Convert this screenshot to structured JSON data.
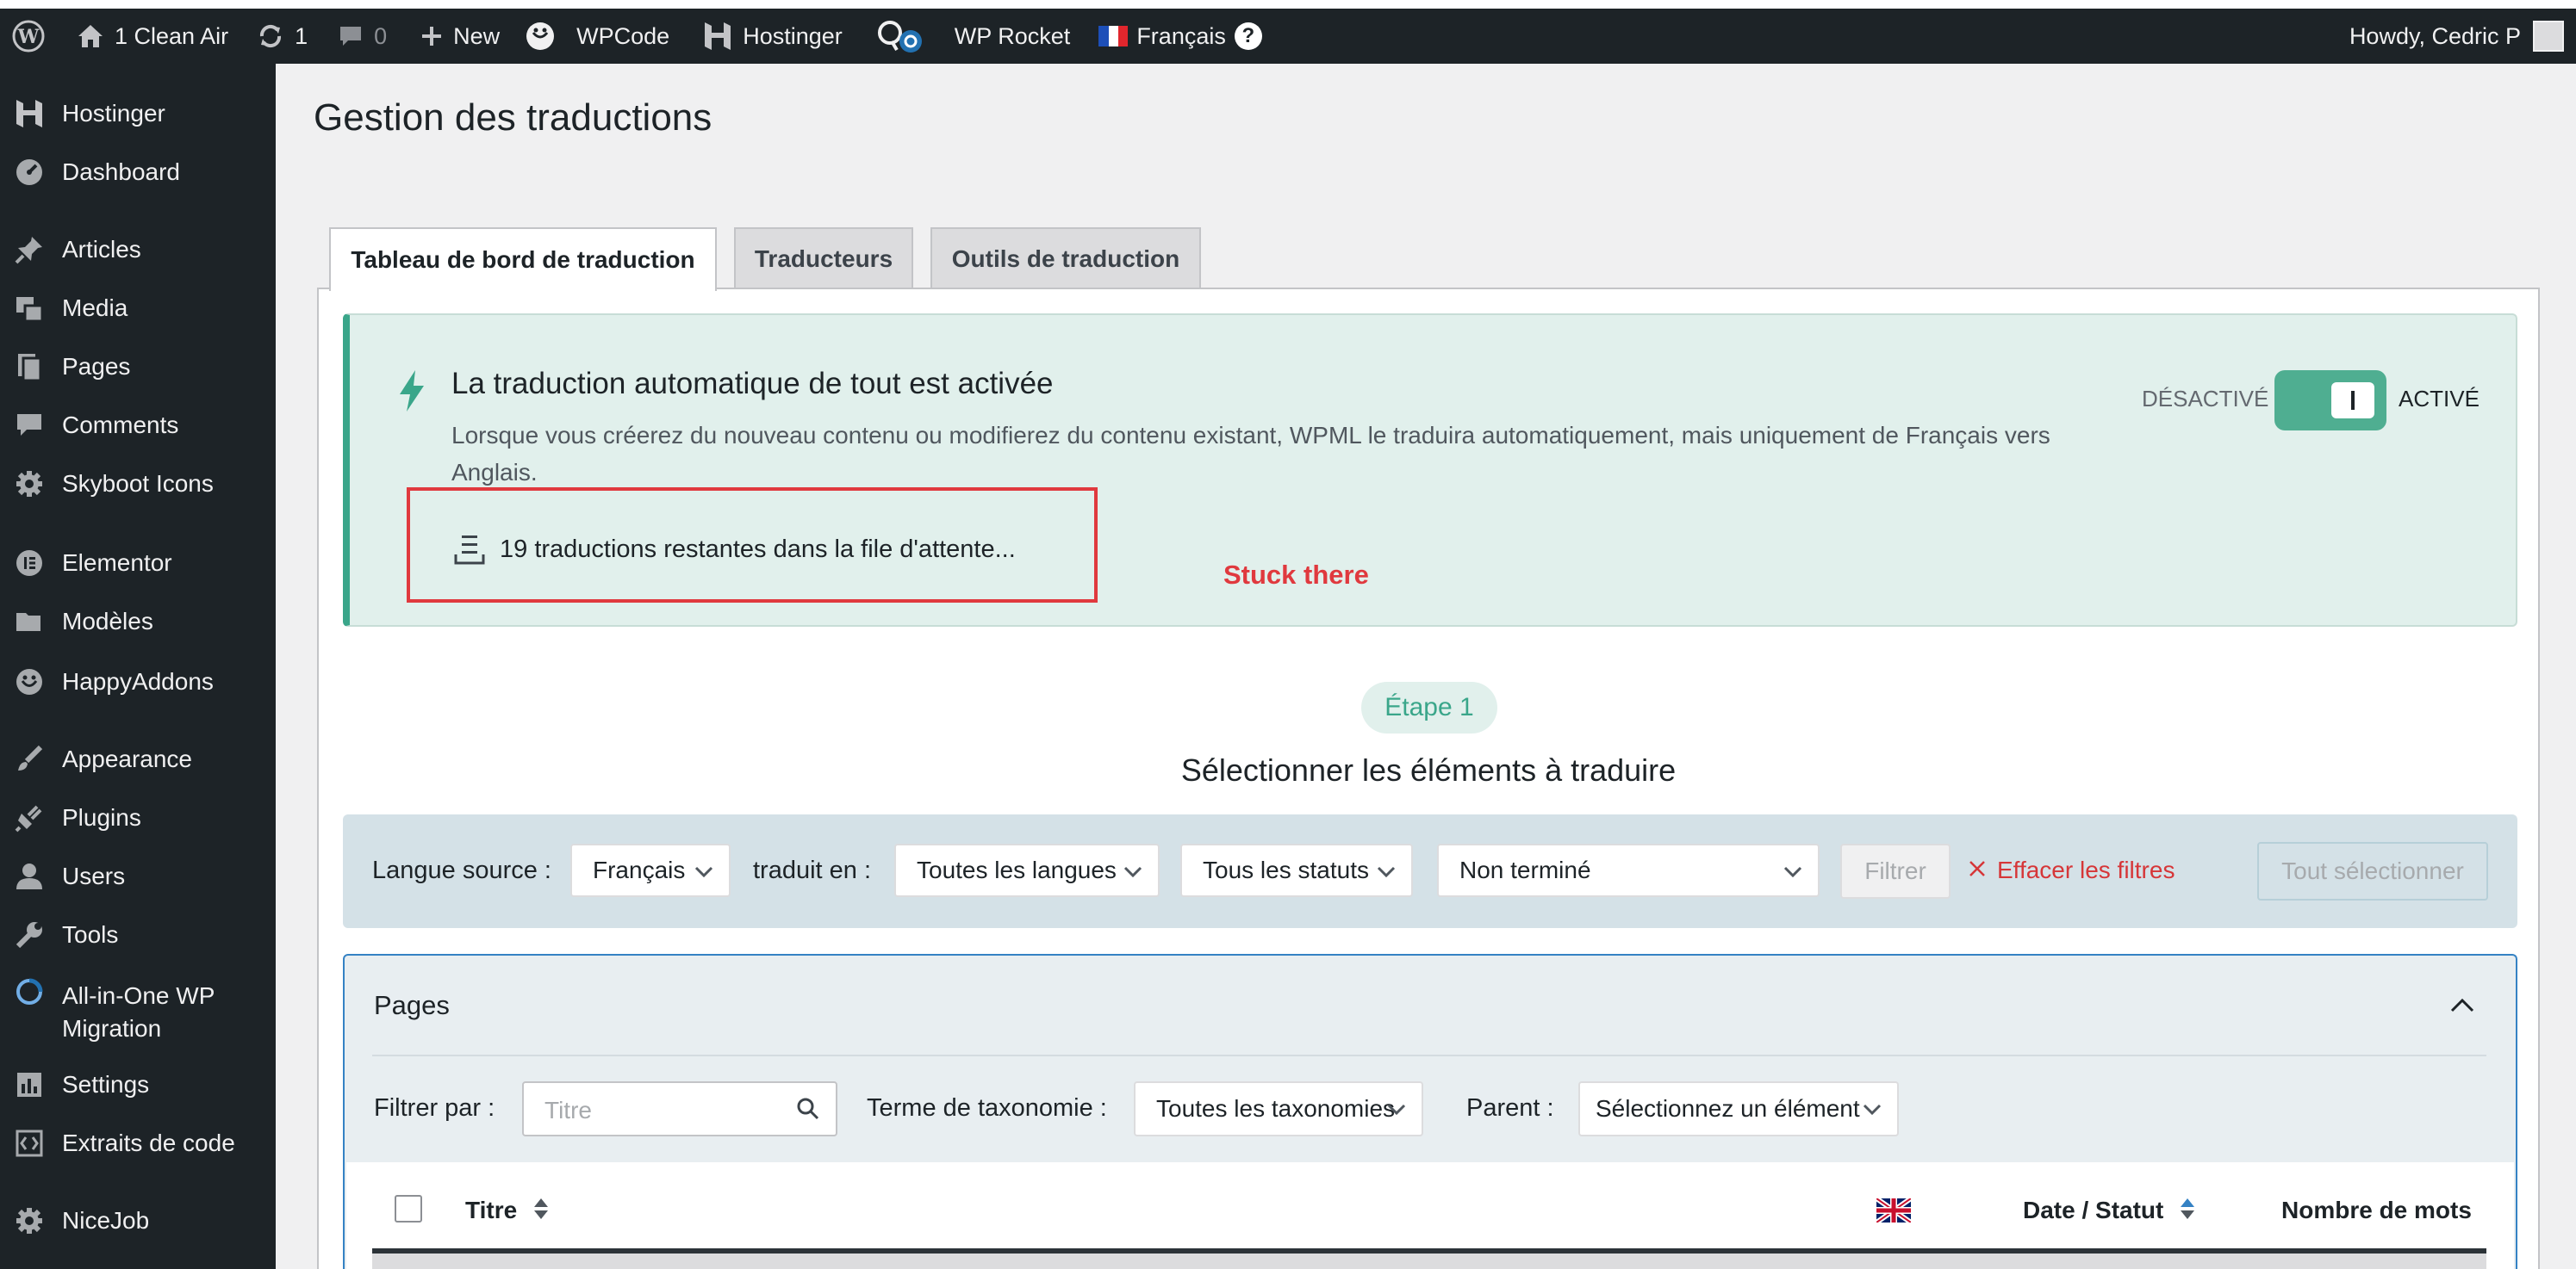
{
  "adminbar": {
    "site_name": "1 Clean Air",
    "updates_count": "1",
    "comments_count": "0",
    "new_label": "New",
    "wpcode_label": "WPCode",
    "hostinger_label": "Hostinger",
    "wprocket_label": "WP Rocket",
    "language_label": "Français",
    "howdy": "Howdy, Cedric P"
  },
  "sidebar": {
    "items": [
      {
        "label": "Hostinger",
        "icon": "hostinger-icon"
      },
      {
        "label": "Dashboard",
        "icon": "dashboard-icon"
      },
      {
        "label": "Articles",
        "icon": "pin-icon"
      },
      {
        "label": "Media",
        "icon": "media-icon"
      },
      {
        "label": "Pages",
        "icon": "pages-icon"
      },
      {
        "label": "Comments",
        "icon": "comment-icon"
      },
      {
        "label": "Skyboot Icons",
        "icon": "gear-icon"
      },
      {
        "label": "Elementor",
        "icon": "elementor-icon"
      },
      {
        "label": "Modèles",
        "icon": "folder-icon"
      },
      {
        "label": "HappyAddons",
        "icon": "happy-icon"
      },
      {
        "label": "Appearance",
        "icon": "brush-icon"
      },
      {
        "label": "Plugins",
        "icon": "plugin-icon"
      },
      {
        "label": "Users",
        "icon": "user-icon"
      },
      {
        "label": "Tools",
        "icon": "wrench-icon"
      },
      {
        "label": "All-in-One WP",
        "label2": "Migration",
        "icon": "migration-icon"
      },
      {
        "label": "Settings",
        "icon": "settings-icon"
      },
      {
        "label": "Extraits de code",
        "icon": "code-icon"
      },
      {
        "label": "NiceJob",
        "icon": "gear-icon"
      }
    ]
  },
  "page": {
    "title": "Gestion des traductions",
    "tabs": [
      {
        "label": "Tableau de bord de traduction",
        "active": true
      },
      {
        "label": "Traducteurs",
        "active": false
      },
      {
        "label": "Outils de traduction",
        "active": false
      }
    ]
  },
  "notice": {
    "title": "La traduction automatique de tout est activée",
    "text": "Lorsque vous créerez du nouveau contenu ou modifierez du contenu existant, WPML le traduira automatiquement, mais uniquement de Français vers Anglais.",
    "queue": "19 traductions restantes dans la file d'attente...",
    "annotation": "Stuck there",
    "toggle_off": "DÉSACTIVÉ",
    "toggle_on": "ACTIVÉ",
    "toggle_state": "on"
  },
  "step": {
    "pill": "Étape 1",
    "title": "Sélectionner les éléments à traduire"
  },
  "filters": {
    "source_label": "Langue source :",
    "source_value": "Français",
    "target_label": "traduit en :",
    "target_value": "Toutes les langues",
    "status_value": "Tous les statuts",
    "progress_value": "Non terminé",
    "filter_button": "Filtrer",
    "clear_label": "Effacer les filtres",
    "select_all": "Tout sélectionner"
  },
  "pages_section": {
    "title": "Pages",
    "filter_label": "Filtrer par :",
    "search_placeholder": "Titre",
    "taxonomy_label": "Terme de taxonomie :",
    "taxonomy_value": "Toutes les taxonomies",
    "parent_label": "Parent :",
    "parent_value": "Sélectionnez un élément",
    "columns": {
      "title": "Titre",
      "date_status": "Date / Statut",
      "word_count": "Nombre de mots"
    }
  },
  "colors": {
    "adminbar_bg": "#1d2327",
    "accent_green": "#3aa68a",
    "toggle_green": "#4fae91",
    "annotation_red": "#e0393e",
    "link_red": "#d63638",
    "section_blue": "#3582c4"
  }
}
